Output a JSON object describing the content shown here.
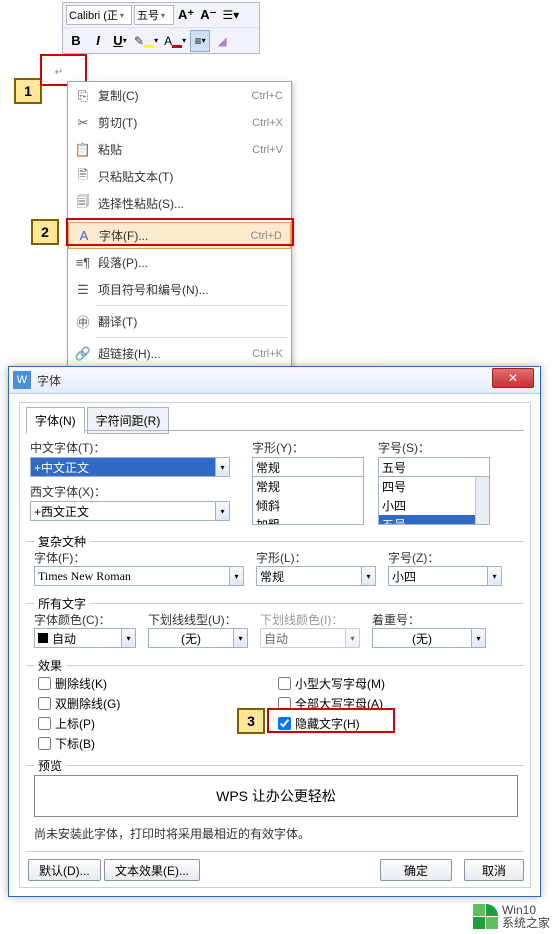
{
  "toolbar": {
    "font_name": "Calibri (正",
    "font_size": "五号",
    "increase": "A⁺",
    "decrease": "A⁻",
    "bold": "B",
    "italic": "I",
    "underline": "U"
  },
  "steps": {
    "s1": "1",
    "s2": "2",
    "s3": "3"
  },
  "ctx": {
    "copy": "复制(C)",
    "copy_sc": "Ctrl+C",
    "cut": "剪切(T)",
    "cut_sc": "Ctrl+X",
    "paste": "粘贴",
    "paste_sc": "Ctrl+V",
    "paste_text": "只粘贴文本(T)",
    "paste_special": "选择性粘贴(S)...",
    "font": "字体(F)...",
    "font_sc": "Ctrl+D",
    "para": "段落(P)...",
    "bullets": "项目符号和编号(N)...",
    "translate": "翻译(T)",
    "hyperlink": "超链接(H)...",
    "hyperlink_sc": "Ctrl+K"
  },
  "dlg": {
    "title": "字体",
    "tab_font": "字体(N)",
    "tab_spacing": "字符间距(R)",
    "cn_font_lbl": "中文字体(T)：",
    "cn_font_val": "+中文正文",
    "en_font_lbl": "西文字体(X)：",
    "en_font_val": "+西文正文",
    "style_lbl": "字形(Y)：",
    "style_val": "常规",
    "style_opts": [
      "常规",
      "倾斜",
      "加粗"
    ],
    "size_lbl": "字号(S)：",
    "size_val": "五号",
    "size_opts": [
      "四号",
      "小四",
      "五号"
    ],
    "complex_legend": "复杂文种",
    "cx_font_lbl": "字体(F)：",
    "cx_font_val": "Times New Roman",
    "cx_style_lbl": "字形(L)：",
    "cx_style_val": "常规",
    "cx_size_lbl": "字号(Z)：",
    "cx_size_val": "小四",
    "all_legend": "所有文字",
    "color_lbl": "字体颜色(C)：",
    "color_val": "自动",
    "ul_lbl": "下划线线型(U)：",
    "ul_val": "(无)",
    "ulc_lbl": "下划线颜色(I)：",
    "ulc_val": "自动",
    "em_lbl": "着重号：",
    "em_val": "(无)",
    "effects_legend": "效果",
    "e_strike": "删除线(K)",
    "e_dstrike": "双删除线(G)",
    "e_super": "上标(P)",
    "e_sub": "下标(B)",
    "e_small": "小型大写字母(M)",
    "e_all": "全部大写字母(A)",
    "e_hidden": "隐藏文字(H)",
    "preview_legend": "预览",
    "preview_text": "WPS 让办公更轻松",
    "preview_note": "尚未安装此字体，打印时将采用最相近的有效字体。",
    "btn_default": "默认(D)...",
    "btn_effects": "文本效果(E)...",
    "btn_ok": "确定",
    "btn_cancel": "取消"
  },
  "watermark": {
    "line1": "Win10",
    "line2": "系统之家"
  }
}
